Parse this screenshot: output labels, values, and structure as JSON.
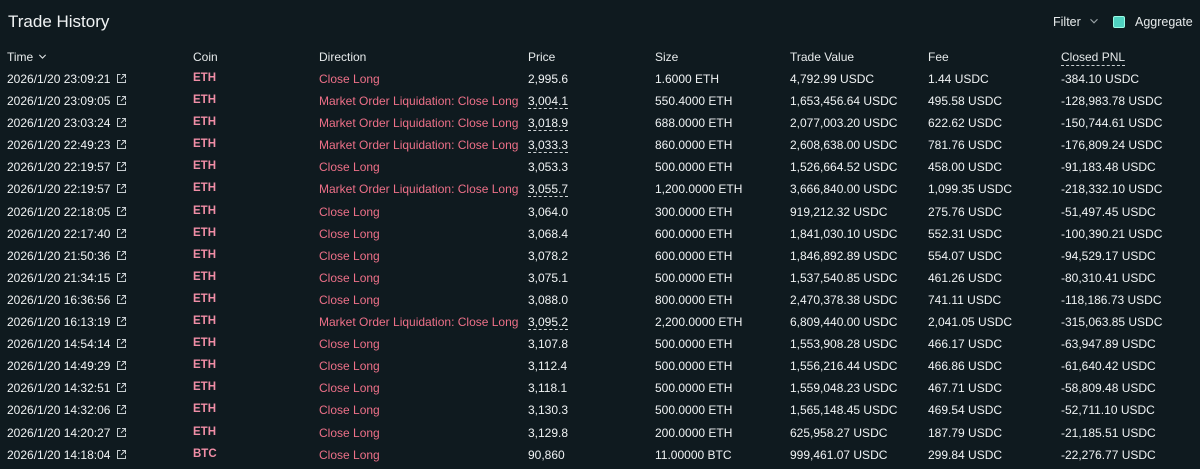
{
  "header": {
    "title": "Trade History",
    "filter_label": "Filter",
    "aggregate_label": "Aggregate",
    "aggregate_checked": true
  },
  "colors": {
    "background": "#0f1a1f",
    "coin": "#f08ea6",
    "direction": "#ed7088",
    "checkbox": "#50d2c1"
  },
  "columns": {
    "time": "Time",
    "coin": "Coin",
    "direction": "Direction",
    "price": "Price",
    "size": "Size",
    "trade_value": "Trade Value",
    "fee": "Fee",
    "closed_pnl": "Closed PNL"
  },
  "icons": {
    "sort": "chevron-down-icon",
    "filter": "chevron-down-icon",
    "row_link": "external-link-icon"
  },
  "trades": [
    {
      "time": "2026/1/20 23:09:21",
      "coin": "ETH",
      "direction": "Close Long",
      "price": "2,995.6",
      "price_dashed": false,
      "size": "1.6000 ETH",
      "trade_value": "4,792.99 USDC",
      "fee": "1.44 USDC",
      "closed_pnl": "-384.10 USDC"
    },
    {
      "time": "2026/1/20 23:09:05",
      "coin": "ETH",
      "direction": "Market Order Liquidation: Close Long",
      "price": "3,004.1",
      "price_dashed": true,
      "size": "550.4000 ETH",
      "trade_value": "1,653,456.64 USDC",
      "fee": "495.58 USDC",
      "closed_pnl": "-128,983.78 USDC"
    },
    {
      "time": "2026/1/20 23:03:24",
      "coin": "ETH",
      "direction": "Market Order Liquidation: Close Long",
      "price": "3,018.9",
      "price_dashed": true,
      "size": "688.0000 ETH",
      "trade_value": "2,077,003.20 USDC",
      "fee": "622.62 USDC",
      "closed_pnl": "-150,744.61 USDC"
    },
    {
      "time": "2026/1/20 22:49:23",
      "coin": "ETH",
      "direction": "Market Order Liquidation: Close Long",
      "price": "3,033.3",
      "price_dashed": true,
      "size": "860.0000 ETH",
      "trade_value": "2,608,638.00 USDC",
      "fee": "781.76 USDC",
      "closed_pnl": "-176,809.24 USDC"
    },
    {
      "time": "2026/1/20 22:19:57",
      "coin": "ETH",
      "direction": "Close Long",
      "price": "3,053.3",
      "price_dashed": false,
      "size": "500.0000 ETH",
      "trade_value": "1,526,664.52 USDC",
      "fee": "458.00 USDC",
      "closed_pnl": "-91,183.48 USDC"
    },
    {
      "time": "2026/1/20 22:19:57",
      "coin": "ETH",
      "direction": "Market Order Liquidation: Close Long",
      "price": "3,055.7",
      "price_dashed": true,
      "size": "1,200.0000 ETH",
      "trade_value": "3,666,840.00 USDC",
      "fee": "1,099.35 USDC",
      "closed_pnl": "-218,332.10 USDC"
    },
    {
      "time": "2026/1/20 22:18:05",
      "coin": "ETH",
      "direction": "Close Long",
      "price": "3,064.0",
      "price_dashed": false,
      "size": "300.0000 ETH",
      "trade_value": "919,212.32 USDC",
      "fee": "275.76 USDC",
      "closed_pnl": "-51,497.45 USDC"
    },
    {
      "time": "2026/1/20 22:17:40",
      "coin": "ETH",
      "direction": "Close Long",
      "price": "3,068.4",
      "price_dashed": false,
      "size": "600.0000 ETH",
      "trade_value": "1,841,030.10 USDC",
      "fee": "552.31 USDC",
      "closed_pnl": "-100,390.21 USDC"
    },
    {
      "time": "2026/1/20 21:50:36",
      "coin": "ETH",
      "direction": "Close Long",
      "price": "3,078.2",
      "price_dashed": false,
      "size": "600.0000 ETH",
      "trade_value": "1,846,892.89 USDC",
      "fee": "554.07 USDC",
      "closed_pnl": "-94,529.17 USDC"
    },
    {
      "time": "2026/1/20 21:34:15",
      "coin": "ETH",
      "direction": "Close Long",
      "price": "3,075.1",
      "price_dashed": false,
      "size": "500.0000 ETH",
      "trade_value": "1,537,540.85 USDC",
      "fee": "461.26 USDC",
      "closed_pnl": "-80,310.41 USDC"
    },
    {
      "time": "2026/1/20 16:36:56",
      "coin": "ETH",
      "direction": "Close Long",
      "price": "3,088.0",
      "price_dashed": false,
      "size": "800.0000 ETH",
      "trade_value": "2,470,378.38 USDC",
      "fee": "741.11 USDC",
      "closed_pnl": "-118,186.73 USDC"
    },
    {
      "time": "2026/1/20 16:13:19",
      "coin": "ETH",
      "direction": "Market Order Liquidation: Close Long",
      "price": "3,095.2",
      "price_dashed": true,
      "size": "2,200.0000 ETH",
      "trade_value": "6,809,440.00 USDC",
      "fee": "2,041.05 USDC",
      "closed_pnl": "-315,063.85 USDC"
    },
    {
      "time": "2026/1/20 14:54:14",
      "coin": "ETH",
      "direction": "Close Long",
      "price": "3,107.8",
      "price_dashed": false,
      "size": "500.0000 ETH",
      "trade_value": "1,553,908.28 USDC",
      "fee": "466.17 USDC",
      "closed_pnl": "-63,947.89 USDC"
    },
    {
      "time": "2026/1/20 14:49:29",
      "coin": "ETH",
      "direction": "Close Long",
      "price": "3,112.4",
      "price_dashed": false,
      "size": "500.0000 ETH",
      "trade_value": "1,556,216.44 USDC",
      "fee": "466.86 USDC",
      "closed_pnl": "-61,640.42 USDC"
    },
    {
      "time": "2026/1/20 14:32:51",
      "coin": "ETH",
      "direction": "Close Long",
      "price": "3,118.1",
      "price_dashed": false,
      "size": "500.0000 ETH",
      "trade_value": "1,559,048.23 USDC",
      "fee": "467.71 USDC",
      "closed_pnl": "-58,809.48 USDC"
    },
    {
      "time": "2026/1/20 14:32:06",
      "coin": "ETH",
      "direction": "Close Long",
      "price": "3,130.3",
      "price_dashed": false,
      "size": "500.0000 ETH",
      "trade_value": "1,565,148.45 USDC",
      "fee": "469.54 USDC",
      "closed_pnl": "-52,711.10 USDC"
    },
    {
      "time": "2026/1/20 14:20:27",
      "coin": "ETH",
      "direction": "Close Long",
      "price": "3,129.8",
      "price_dashed": false,
      "size": "200.0000 ETH",
      "trade_value": "625,958.27 USDC",
      "fee": "187.79 USDC",
      "closed_pnl": "-21,185.51 USDC"
    },
    {
      "time": "2026/1/20 14:18:04",
      "coin": "BTC",
      "direction": "Close Long",
      "price": "90,860",
      "price_dashed": false,
      "size": "11.00000 BTC",
      "trade_value": "999,461.07 USDC",
      "fee": "299.84 USDC",
      "closed_pnl": "-22,276.77 USDC"
    }
  ]
}
